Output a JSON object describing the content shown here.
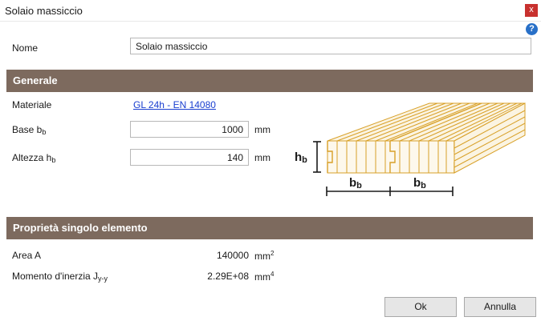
{
  "window": {
    "title": "Solaio massiccio",
    "close_glyph": "x"
  },
  "help": {
    "glyph": "?"
  },
  "name_row": {
    "label": "Nome",
    "value": "Solaio massiccio"
  },
  "general": {
    "header": "Generale",
    "material_label": "Materiale",
    "material_value": "GL 24h - EN 14080",
    "base_label": "Base b",
    "base_sub": "b",
    "base_value": "1000",
    "base_unit": "mm",
    "height_label": "Altezza h",
    "height_sub": "b",
    "height_value": "140",
    "height_unit": "mm"
  },
  "diagram": {
    "h_main": "h",
    "h_sub": "b",
    "b_main": "b",
    "b_sub": "b"
  },
  "props": {
    "header": "Proprietà singolo elemento",
    "area_label": "Area A",
    "area_value": "140000",
    "area_unit": "mm",
    "area_exp": "2",
    "inertia_label": "Momento d'inerzia J",
    "inertia_sub": "y-y",
    "inertia_value": "2.29E+08",
    "inertia_unit": "mm",
    "inertia_exp": "4"
  },
  "buttons": {
    "ok": "Ok",
    "cancel": "Annulla"
  },
  "colors": {
    "section_bg": "#7d6a5e",
    "wood_stroke": "#d8a028",
    "link": "#1a3fd0"
  },
  "icons": {
    "help": "help-icon",
    "close": "close-icon"
  }
}
